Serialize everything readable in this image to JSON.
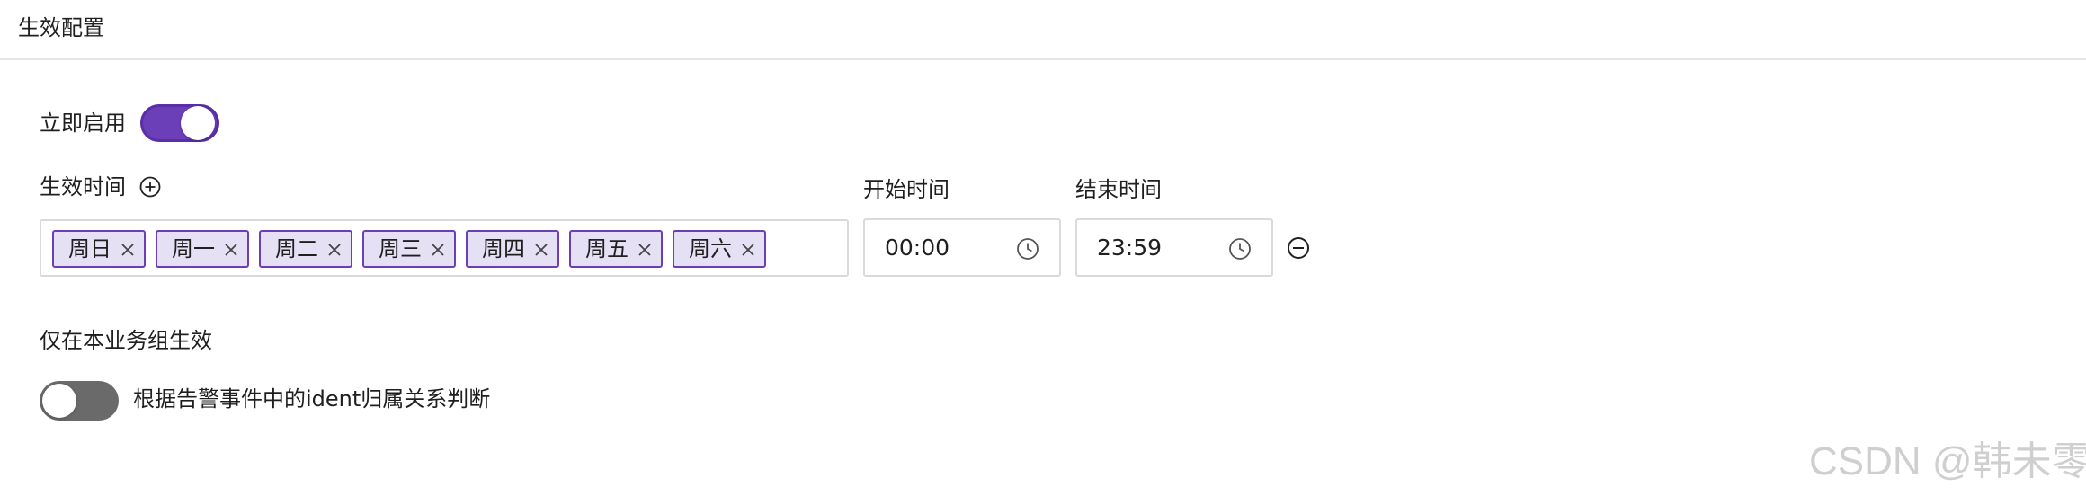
{
  "section": {
    "title": "生效配置"
  },
  "enable_now": {
    "label": "立即启用",
    "value": true
  },
  "effective_time": {
    "label": "生效时间",
    "add_icon": "plus-circle-icon",
    "days": [
      {
        "label": "周日"
      },
      {
        "label": "周一"
      },
      {
        "label": "周二"
      },
      {
        "label": "周三"
      },
      {
        "label": "周四"
      },
      {
        "label": "周五"
      },
      {
        "label": "周六"
      }
    ],
    "start": {
      "label": "开始时间",
      "value": "00:00",
      "icon": "clock-icon"
    },
    "end": {
      "label": "结束时间",
      "value": "23:59",
      "icon": "clock-icon"
    },
    "remove_icon": "minus-circle-icon"
  },
  "business_group": {
    "label": "仅在本业务组生效",
    "toggle_value": false,
    "description": "根据告警事件中的ident归属关系判断"
  },
  "watermark": "CSDN @韩未零",
  "colors": {
    "accent": "#6b3fb8",
    "tag_bg": "#e6e0f5",
    "toggle_off": "#6a6a6a",
    "border": "#d9d9d9"
  }
}
